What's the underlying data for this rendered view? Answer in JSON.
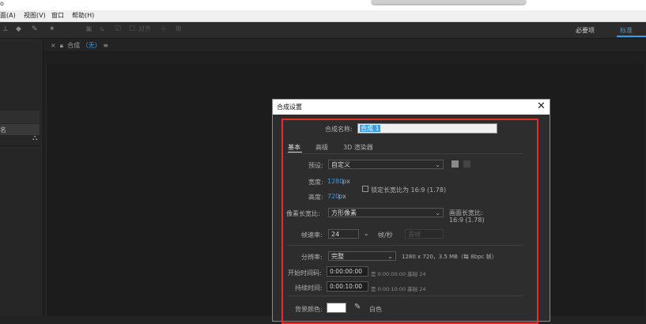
{
  "colors": {
    "accent": "#3a9ce4",
    "highlight_box": "#e1302b"
  },
  "topstrip": {
    "letter": "o"
  },
  "menubar": {
    "items": [
      "面(A)",
      "视图(V)",
      "窗口",
      "帮助(H)"
    ]
  },
  "toolbar": {
    "icons": [
      "stamp-tool-icon",
      "eraser-tool-icon",
      "roto-brush-icon",
      "puppet-pin-icon",
      "align-icon",
      "snap-icon",
      "checkbox-icon"
    ],
    "snap_label": "对齐",
    "workspace_essentials": "必要项",
    "workspace_standard": "标准"
  },
  "comp_panel": {
    "close_glyph": "×",
    "tab_label": "合成",
    "tab_value": "（无）",
    "menu_glyph": "≡"
  },
  "dialog": {
    "title": "合成设置",
    "comp_name_label": "合成名称:",
    "comp_name_value": "合成 1",
    "tabs": [
      "基本",
      "高级",
      "3D 渲染器"
    ],
    "preset_label": "预设:",
    "preset_value": "自定义",
    "width_label": "宽度:",
    "width_value": "1280",
    "height_label": "高度:",
    "height_value": "720",
    "px_unit": "px",
    "lock_aspect_label": "锁定长宽比为 16:9 (1.78)",
    "pixel_aspect_label": "像素长宽比:",
    "pixel_aspect_value": "方形像素",
    "frame_aspect_label": "画面长宽比:",
    "frame_aspect_value": "16:9 (1.78)",
    "frame_rate_label": "帧速率:",
    "frame_rate_value": "24",
    "frame_rate_unit": "帧/秒",
    "frame_rate_mode": "丢帧",
    "resolution_label": "分辨率:",
    "resolution_value": "完整",
    "resolution_info": "1280 x 720，3.5 MB（每 8bpc 帧）",
    "start_timecode_label": "开始时间码:",
    "start_timecode_value": "0:00:00:00",
    "start_timecode_info": "是 0:00:00:00  基础 24",
    "duration_label": "持续时间:",
    "duration_value": "0:00:10:00",
    "duration_info": "是 0:00:10:00  基础 24",
    "bg_color_label": "背景颜色:",
    "bg_color_name": "白色",
    "bg_color_swatch": "#ffffff"
  }
}
